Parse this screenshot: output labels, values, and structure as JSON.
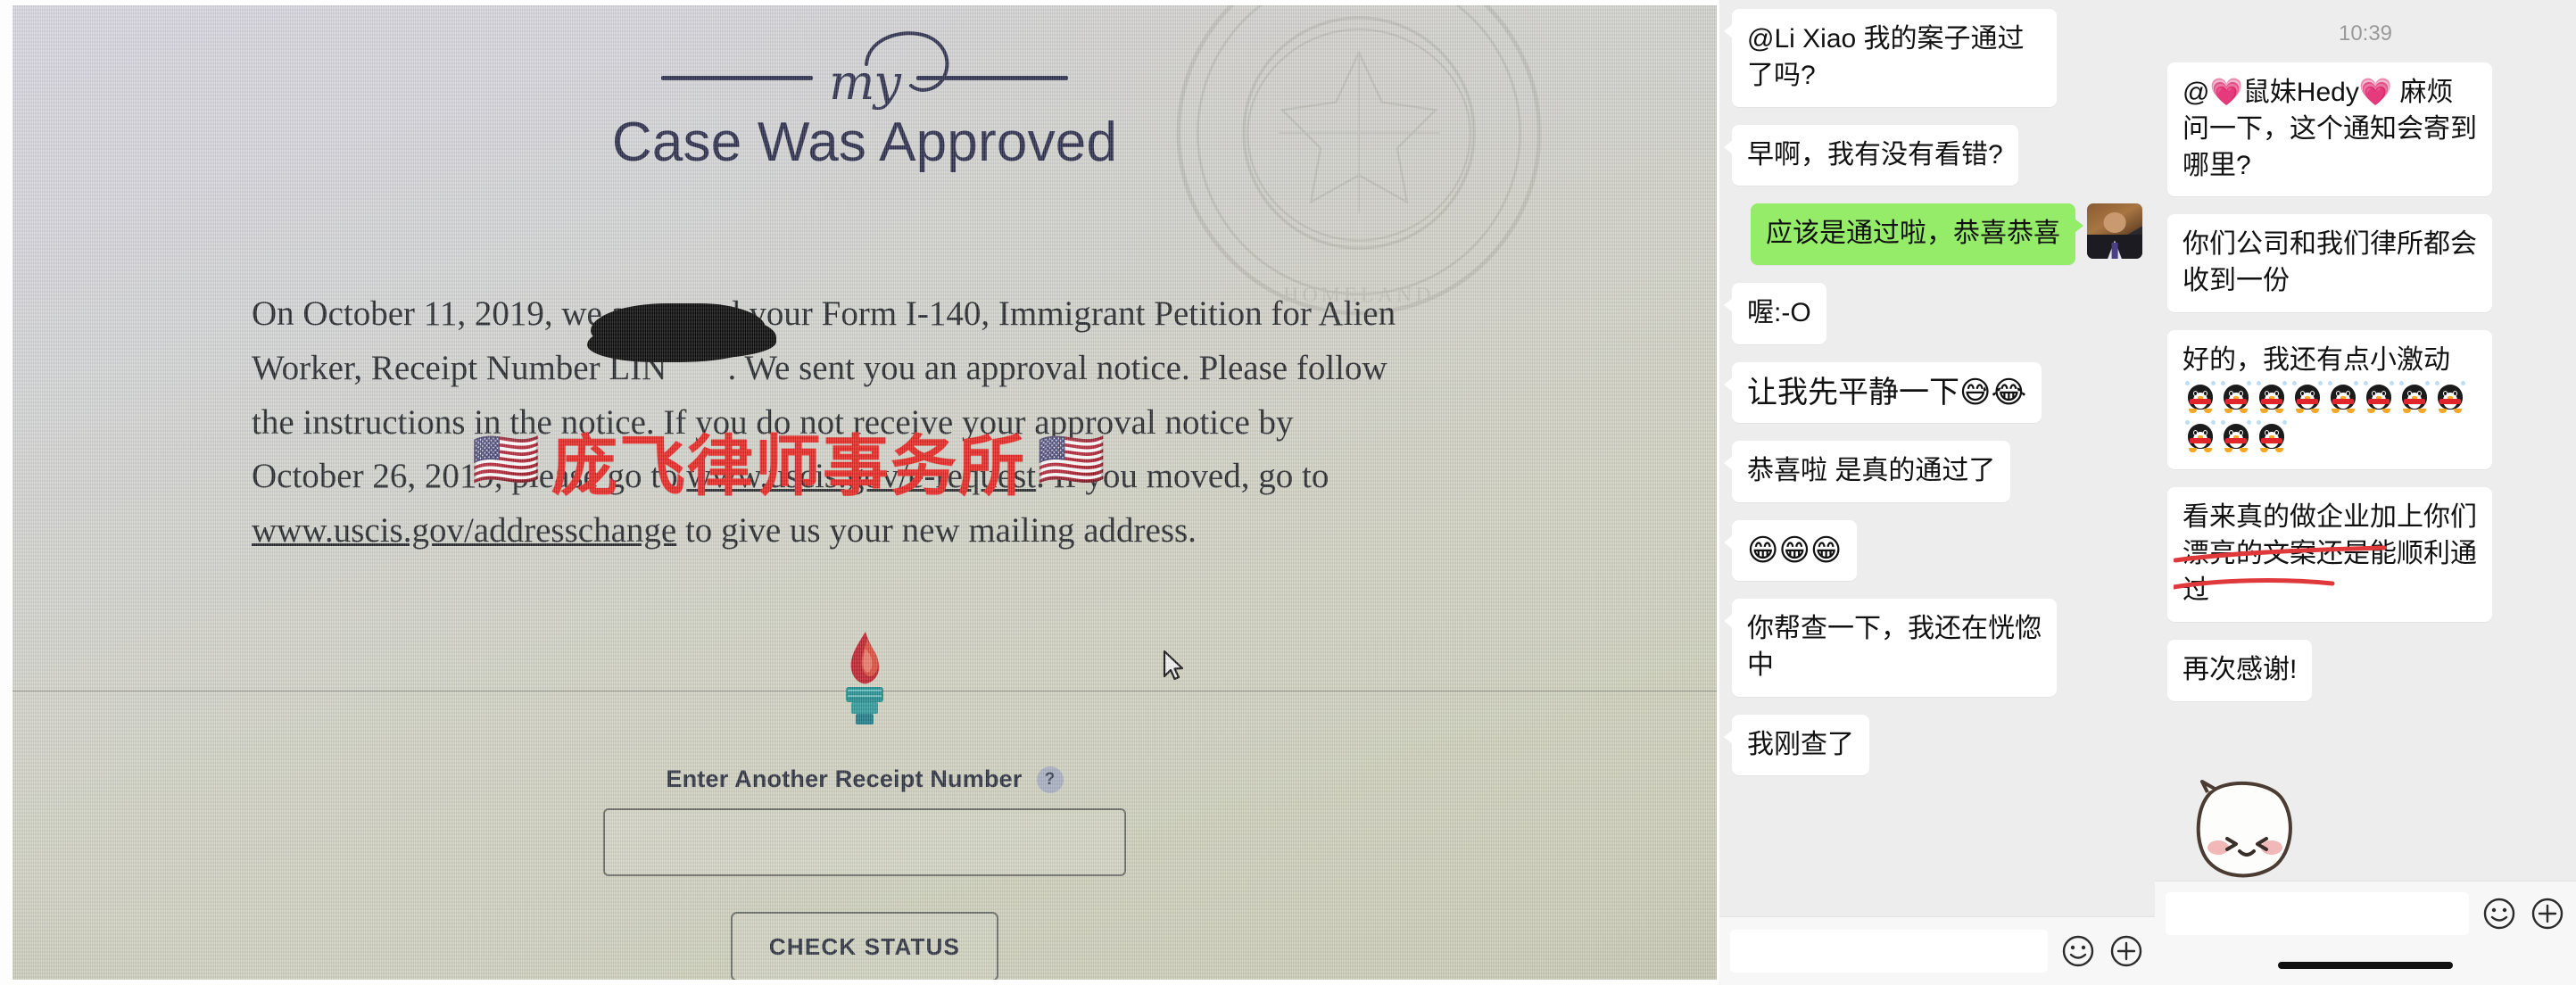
{
  "uscis_page": {
    "brand_script": "my",
    "heading": "Case Was Approved",
    "body_part_1": "On October 11, 2019, we approved your Form I-140, Immigrant Petition for Alien Worker, Receipt Number LIN",
    "body_part_2": ". We sent you an approval notice. Please follow the instructions in the notice. If you do not receive your approval notice by October 26, 2019, please go to ",
    "link_1": "www.uscis.gov/e-request",
    "body_part_3": ". If you moved, go to ",
    "link_2": "www.uscis.gov/addresschange",
    "body_part_4": " to give us your new mailing address.",
    "receipt_label": "Enter Another Receipt Number",
    "help_icon_label": "?",
    "receipt_input_value": "",
    "receipt_input_placeholder": "",
    "check_status_label": "CHECK STATUS",
    "torch_icon": "uscis-torch-icon",
    "seal_icon": "dhs-seal-watermark-icon",
    "cursor_icon": "mouse-pointer-icon",
    "watermark": {
      "text": "庞飞律师事务所",
      "flag_left": "🇺🇸",
      "flag_right": "🇺🇸",
      "color": "#ef2222"
    }
  },
  "colors": {
    "wechat_green_bubble": "#95EC69",
    "wechat_bg": "#EDEDED",
    "white_bubble": "#FFFFFF",
    "watermark_red": "#EF2222",
    "heading_navy": "#2B2D4C",
    "annotation_red": "#E0393B"
  },
  "chat_left": {
    "messages": [
      {
        "side": "in",
        "text": "@Li Xiao 我的案子通过了吗?",
        "avatar": false
      },
      {
        "side": "in",
        "text": "早啊，我有没有看错?",
        "avatar": false
      },
      {
        "side": "out",
        "text": "应该是通过啦，恭喜恭喜",
        "avatar": true
      },
      {
        "side": "in",
        "text": "喔:-O",
        "avatar": false
      },
      {
        "side": "in",
        "text": "让我先平静一下😅😂",
        "avatar": false
      },
      {
        "side": "in",
        "text": "恭喜啦 是真的通过了",
        "avatar": false
      },
      {
        "side": "in",
        "text": "😁😁😁",
        "avatar": false
      },
      {
        "side": "in",
        "text": "你帮查一下，我还在恍惚中",
        "avatar": false
      },
      {
        "side": "in",
        "text": "我刚查了",
        "avatar": false
      }
    ],
    "input_bar": {
      "value": "",
      "emoji_icon": "smiley-face-icon",
      "plus_icon": "plus-circle-icon"
    }
  },
  "chat_right": {
    "timestamp": "10:39",
    "messages": [
      {
        "type": "text",
        "text": "@💗鼠妹Hedy💗 麻烦问一下，这个通知会寄到哪里?"
      },
      {
        "type": "text",
        "text": "你们公司和我们律所都会收到一份"
      },
      {
        "type": "penguin",
        "text": "好的，我还有点小激动",
        "penguin_count": 11
      },
      {
        "type": "text",
        "text": "看来真的做企业加上你们漂亮的文案还是能顺利通过",
        "annotated": true
      },
      {
        "type": "text",
        "text": "再次感谢!"
      },
      {
        "type": "sticker",
        "sticker": "cute-white-blob-sticker"
      }
    ],
    "input_bar": {
      "value": "",
      "emoji_icon": "smiley-face-icon",
      "plus_icon": "plus-circle-icon"
    },
    "home_indicator": "home-indicator-bar"
  }
}
